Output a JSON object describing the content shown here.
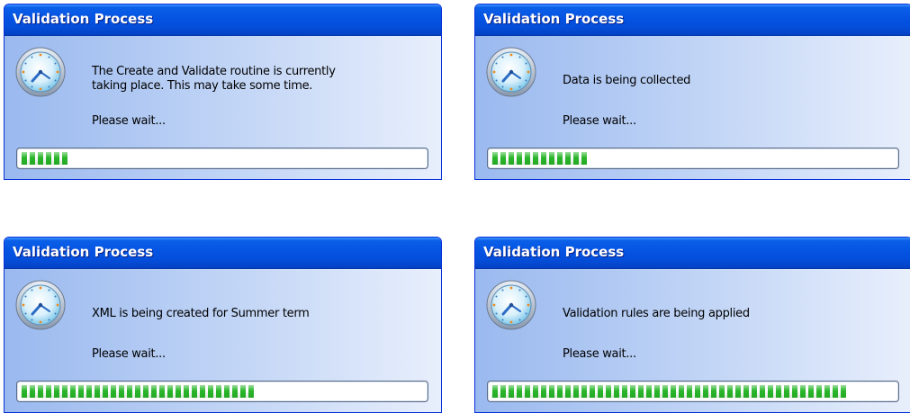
{
  "dialogs": [
    {
      "title": "Validation Process",
      "message_line1": "The Create and Validate routine is currently",
      "message_line2": "taking place. This may take some time.",
      "wait": "Please wait...",
      "progress_percent": 13
    },
    {
      "title": "Validation Process",
      "message_line1": "Data is being collected",
      "message_line2": "",
      "wait": "Please wait...",
      "progress_percent": 25
    },
    {
      "title": "Validation Process",
      "message_line1": "XML is being created for Summer term",
      "message_line2": "",
      "wait": "Please wait...",
      "progress_percent": 59
    },
    {
      "title": "Validation Process",
      "message_line1": "Validation rules are being applied",
      "message_line2": "",
      "wait": "Please wait...",
      "progress_percent": 89
    }
  ],
  "icons": {
    "dialog_icon": "clock-icon"
  },
  "colors": {
    "progress": "#2ab72a",
    "titlebar": "#0553e2"
  }
}
